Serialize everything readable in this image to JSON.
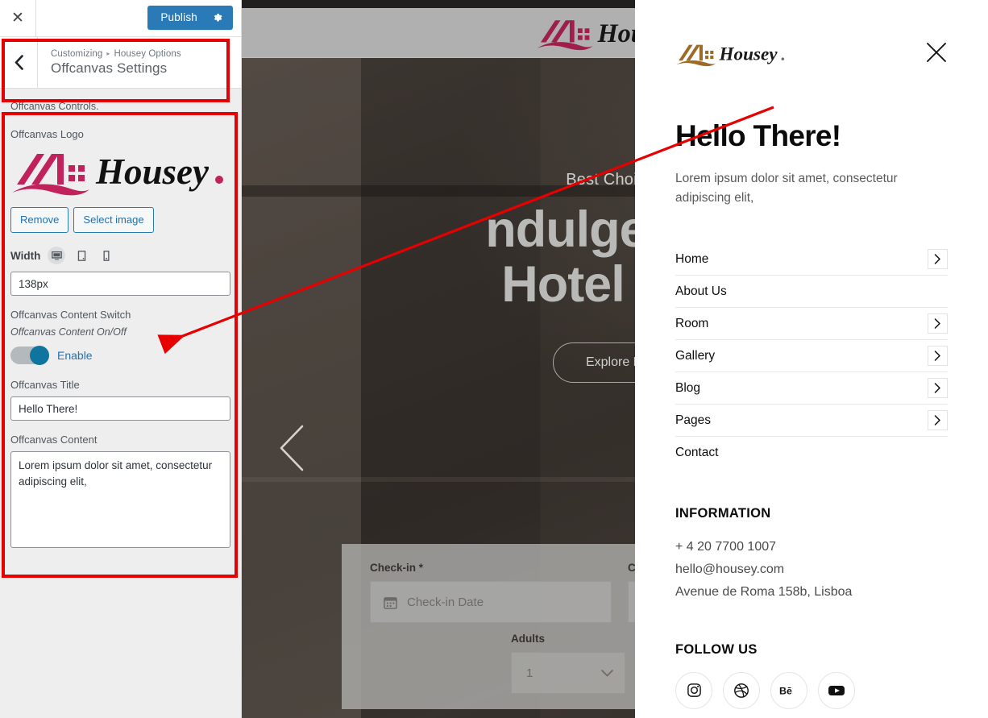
{
  "customizer": {
    "close_icon": "close-icon",
    "publish_label": "Publish",
    "gear_icon": "gear-icon",
    "back_icon": "chevron-left-icon",
    "breadcrumb_root": "Customizing",
    "breadcrumb_sep": "▸",
    "breadcrumb_parent": "Housey Options",
    "section_title": "Offcanvas Settings",
    "controls_desc": "Offcanvas Controls.",
    "logo_label": "Offcanvas Logo",
    "remove_label": "Remove",
    "select_image_label": "Select image",
    "width_label": "Width",
    "devices": [
      {
        "name": "desktop-icon",
        "active": true
      },
      {
        "name": "tablet-icon",
        "active": false
      },
      {
        "name": "mobile-icon",
        "active": false
      }
    ],
    "width_value": "138px",
    "switch_label": "Offcanvas Content Switch",
    "switch_desc": "Offcanvas Content On/Off",
    "toggle_label": "Enable",
    "toggle_on": true,
    "title_label": "Offcanvas Title",
    "title_value": "Hello There!",
    "content_label": "Offcanvas Content",
    "content_value": "Lorem ipsum dolor sit amet, consectetur adipiscing elit,"
  },
  "preview": {
    "logo_alt": "Housey",
    "hero_subtitle": "Best Choice f",
    "hero_title_line1": "ndulge in a",
    "hero_title_line2": "Hotel Exp",
    "hero_button": "Explore M",
    "slider_prev_icon": "chevron-left-icon",
    "booking": {
      "checkin_label": "Check-in *",
      "checkin_placeholder": "Check-in Date",
      "calendar_icon": "calendar-icon",
      "checkout_label": "C",
      "adults_label": "Adults",
      "adults_value": "1",
      "chevron_icon": "chevron-down-icon"
    }
  },
  "offcanvas": {
    "logo_alt": "Housey",
    "close_icon": "close-icon",
    "title": "Hello There!",
    "text": "Lorem ipsum dolor sit amet, consectetur adipiscing elit,",
    "menu": [
      {
        "label": "Home",
        "has_chevron": true
      },
      {
        "label": "About Us",
        "has_chevron": false
      },
      {
        "label": "Room",
        "has_chevron": true
      },
      {
        "label": "Gallery",
        "has_chevron": true
      },
      {
        "label": "Blog",
        "has_chevron": true
      },
      {
        "label": "Pages",
        "has_chevron": true
      },
      {
        "label": "Contact",
        "has_chevron": false
      }
    ],
    "information_heading": "INFORMATION",
    "information_lines": [
      "+ 4 20 7700 1007",
      "hello@housey.com",
      "Avenue de Roma 158b, Lisboa"
    ],
    "follow_heading": "FOLLOW US",
    "socials": [
      {
        "name": "instagram-icon"
      },
      {
        "name": "dribbble-icon"
      },
      {
        "name": "behance-icon"
      },
      {
        "name": "youtube-icon"
      }
    ]
  },
  "colors": {
    "accent_blue": "#2a7ab8",
    "link_blue": "#2271b1",
    "annotation_red": "#e60000",
    "logo_crimson": "#c2225b",
    "logo_bronze": "#9d6b28",
    "panel_bg": "#eeeeee"
  }
}
